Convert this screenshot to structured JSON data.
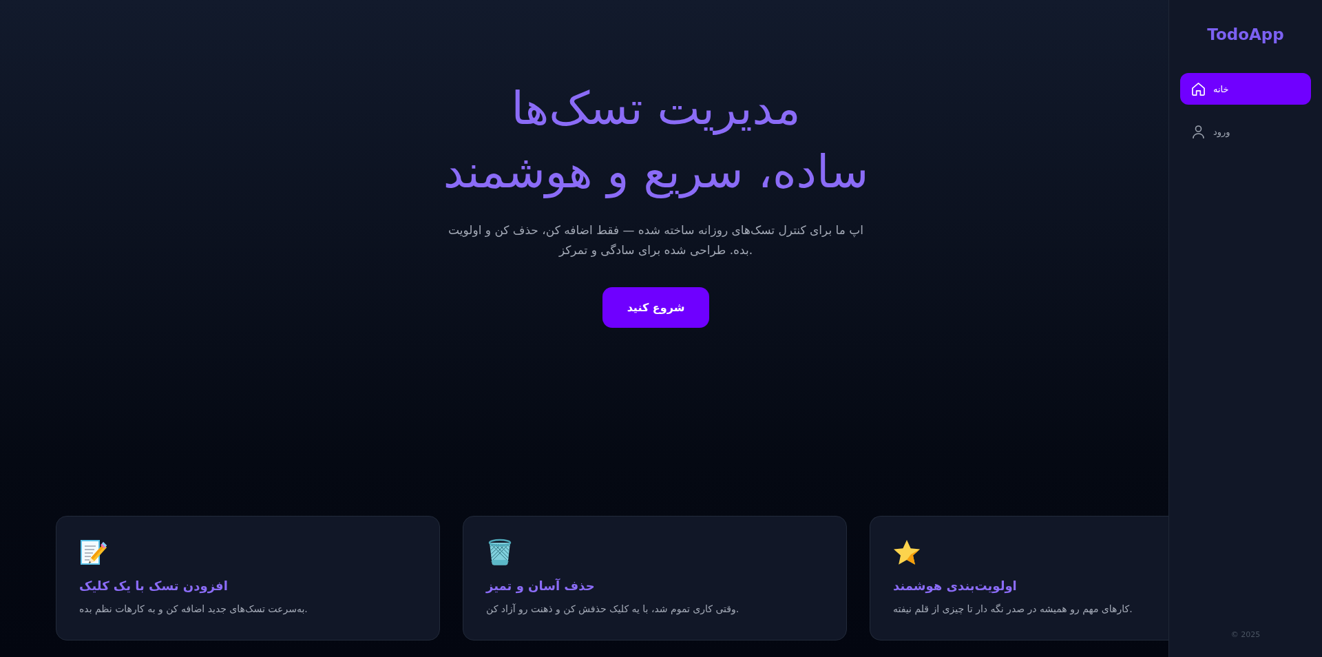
{
  "hero": {
    "title": "مدیریت تسک‌ها\nساده، سریع و هوشمند",
    "subtitle": "اپ ما برای کنترل تسک‌های روزانه ساخته شده — فقط اضافه کن، حذف کن و اولویت بده. طراحی شده برای سادگی و تمرکز.",
    "button": "شروع کنید"
  },
  "features": [
    {
      "title": "اولویت‌بندی هوشمند",
      "text": "کارهای مهم رو همیشه در صدر نگه دار تا چیزی از قلم نیفته."
    },
    {
      "title": "حذف آسان و تمیز",
      "text": "وقتی کاری تموم شد، با یه کلیک حذفش کن و ذهنت رو آزاد کن."
    },
    {
      "title": "افزودن تسک با یک کلیک",
      "text": "به‌سرعت تسک‌های جدید اضافه کن و به کارهات نظم بده."
    }
  ],
  "sidebar": {
    "logo": "TodoApp",
    "items": [
      {
        "label": "خانه",
        "selected": true
      },
      {
        "label": "ورود",
        "selected": false
      }
    ],
    "footer": "© 2025"
  }
}
